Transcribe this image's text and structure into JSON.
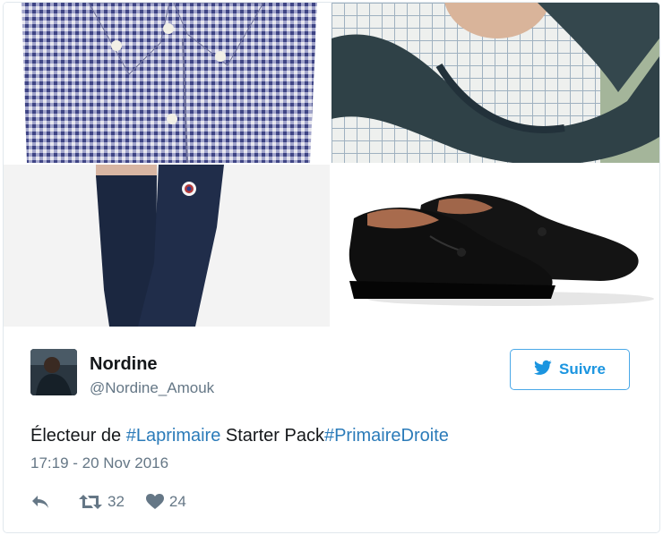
{
  "user": {
    "name": "Nordine",
    "handle": "@Nordine_Amouk"
  },
  "follow_button": {
    "label": "Suivre",
    "icon": "twitter-bird-icon"
  },
  "tweet": {
    "text_parts": [
      "Électeur de ",
      "#Laprimaire",
      " Starter Pack",
      "#PrimaireDroite"
    ],
    "timestamp": "17:19 - 20 Nov 2016"
  },
  "actions": {
    "reply_icon": "reply-icon",
    "retweet_icon": "retweet-icon",
    "retweet_count": "32",
    "like_icon": "heart-icon",
    "like_count": "24"
  },
  "media": [
    {
      "name": "gingham-shirt-photo"
    },
    {
      "name": "sweater-over-shoulders-photo"
    },
    {
      "name": "navy-socks-photo"
    },
    {
      "name": "tassel-loafers-photo"
    }
  ],
  "colors": {
    "link": "#2b7bb9",
    "accent": "#1b95e0",
    "muted": "#657786",
    "text": "#14171a"
  }
}
